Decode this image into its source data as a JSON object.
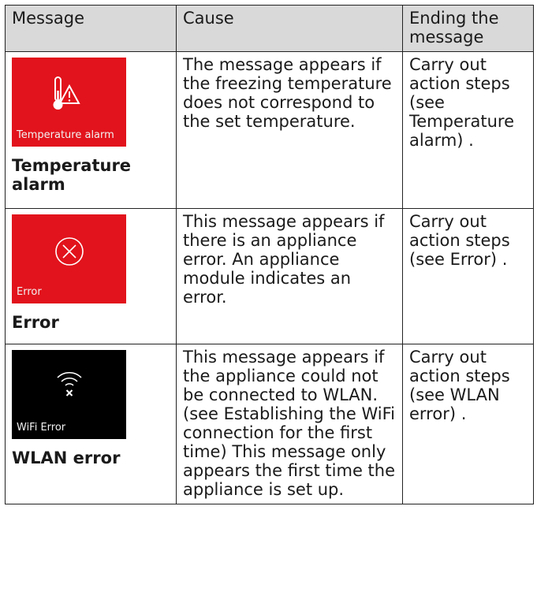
{
  "table": {
    "headers": [
      "Message",
      "Cause",
      "Ending the message"
    ],
    "rows": [
      {
        "screen_color": "#e2131c",
        "screen_label": "Temperature alarm",
        "icon": "thermometer-warning-icon",
        "name": "Temperature alarm",
        "cause": "The message appears if the freezing temperature does not correspond to the set temperature.",
        "ending": "Carry out action steps (see Temperature alarm) ."
      },
      {
        "screen_color": "#e2131c",
        "screen_label": "Error",
        "icon": "error-circle-x-icon",
        "name": "Error",
        "cause": "This message appears if there is an appliance error. An appliance module indicates an error.",
        "ending": "Carry out action steps (see Error) ."
      },
      {
        "screen_color": "#000000",
        "screen_label": "WiFi Error",
        "icon": "wifi-error-icon",
        "name": "WLAN error",
        "cause": "This message appears if the appliance could not be connected to WLAN. (see Establishing the WiFi connection for the first time) This message only appears the first time the appliance is set up.",
        "ending": "Carry out action steps (see WLAN error) ."
      }
    ]
  }
}
